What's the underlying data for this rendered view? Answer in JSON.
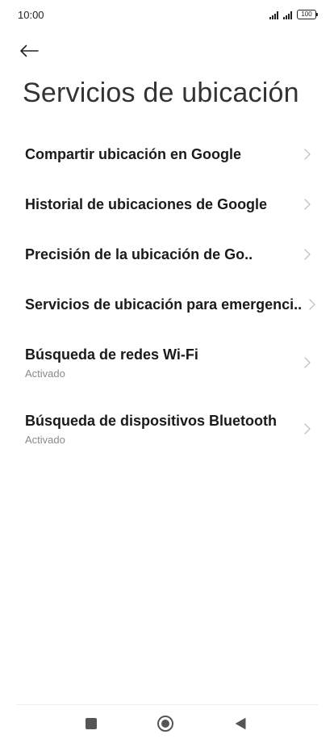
{
  "status_bar": {
    "time": "10:00",
    "battery": "100"
  },
  "header": {
    "title": "Servicios de ubicación"
  },
  "items": [
    {
      "label": "Compartir ubicación en Google"
    },
    {
      "label": "Historial de ubicaciones de Google"
    },
    {
      "label": "Precisión de la ubicación de Go.."
    },
    {
      "label": "Servicios de ubicación para emergenci.."
    },
    {
      "label": "Búsqueda de redes Wi-Fi",
      "sub": "Activado"
    },
    {
      "label": "Búsqueda de dispositivos Bluetooth",
      "sub": "Activado"
    }
  ],
  "icons": {
    "back": "arrow-left-icon",
    "chevron": "chevron-right-icon",
    "nav_recents": "square-icon",
    "nav_home": "circle-icon",
    "nav_back": "triangle-left-icon"
  },
  "colors": {
    "text": "#1a1a1a",
    "subtext": "#8a8a8a",
    "chevron": "#c4c4c4",
    "background": "#ffffff"
  }
}
